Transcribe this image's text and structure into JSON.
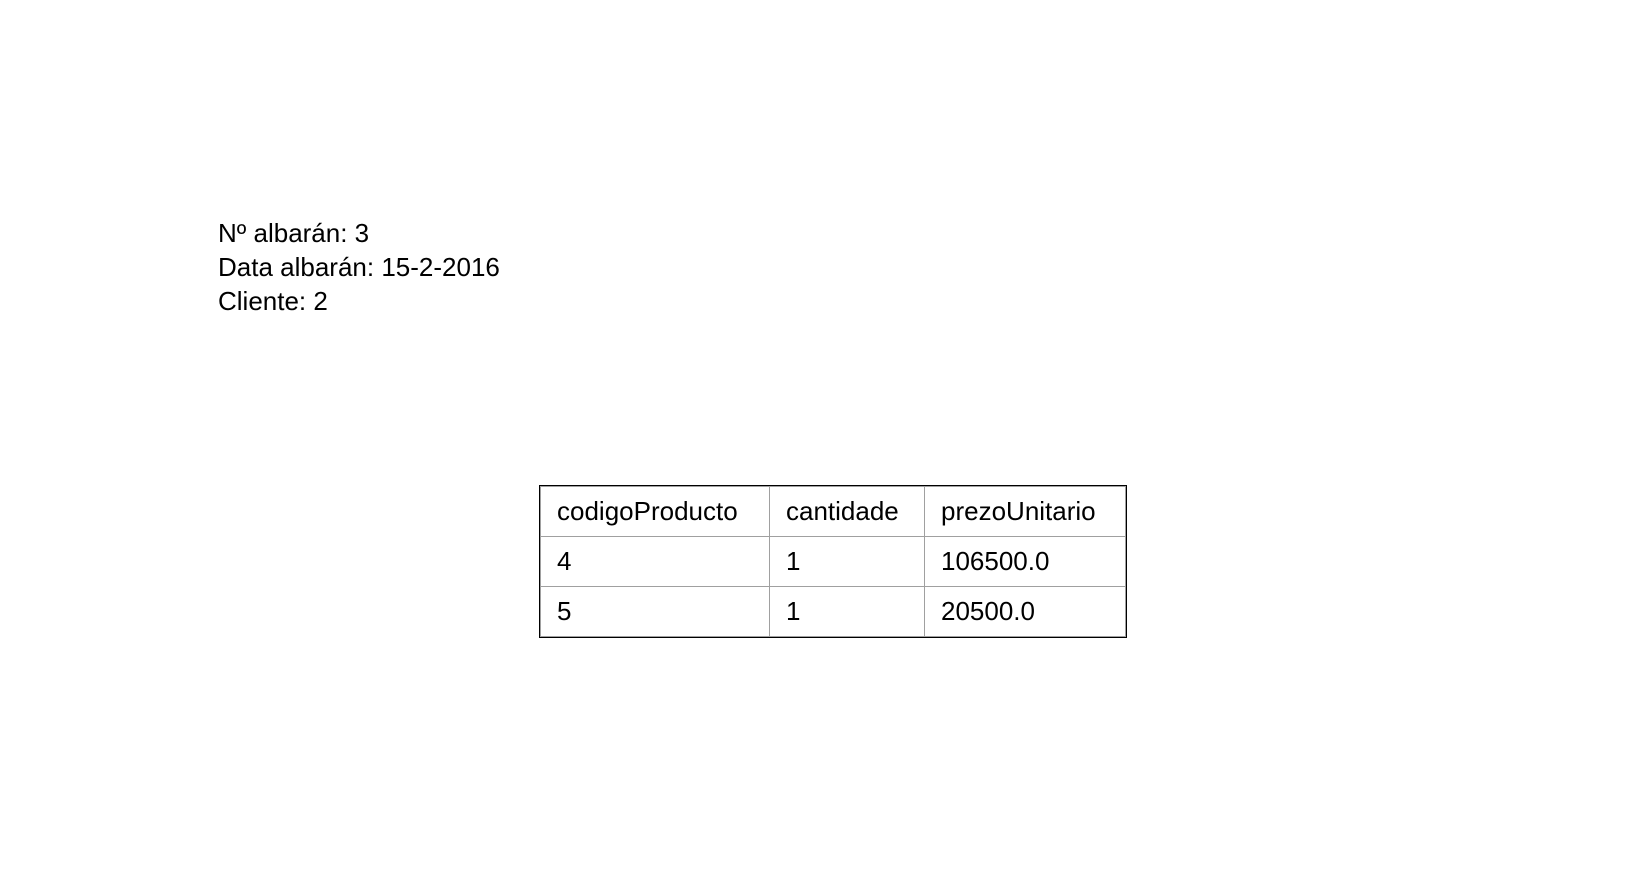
{
  "header": {
    "albaran_number": "Nº albarán: 3",
    "albaran_date": "Data albarán: 15-2-2016",
    "client": "Cliente: 2"
  },
  "table": {
    "columns": [
      "codigoProducto",
      "cantidade",
      "prezoUnitario"
    ],
    "rows": [
      [
        "4",
        "1",
        "106500.0"
      ],
      [
        "5",
        "1",
        "20500.0"
      ]
    ]
  }
}
